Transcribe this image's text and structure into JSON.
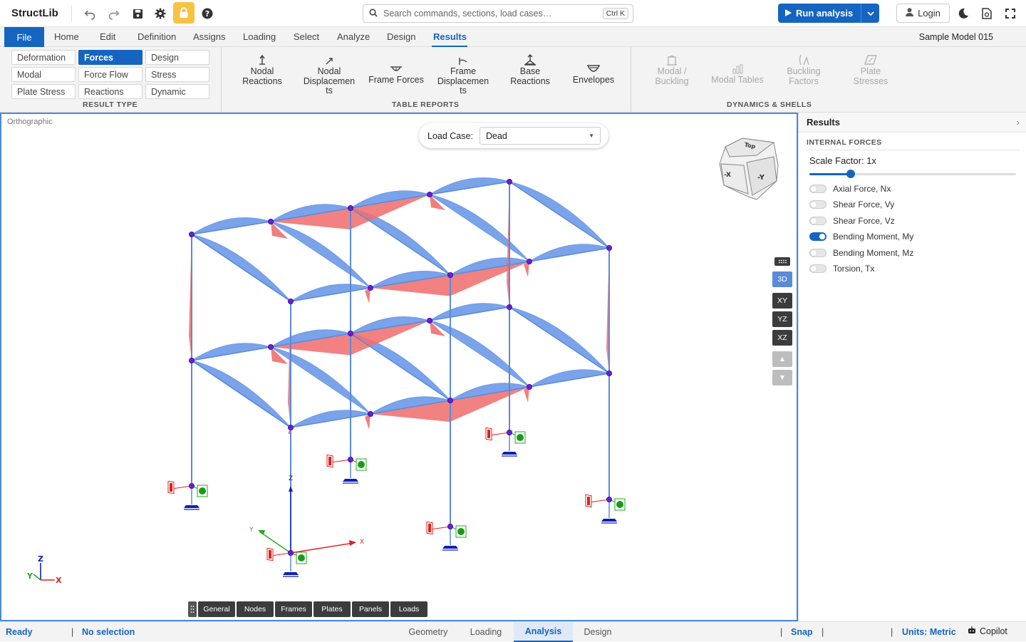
{
  "app": {
    "brand": "StructLib"
  },
  "toolbar": {
    "icons": [
      "undo-icon",
      "redo-icon",
      "save-icon",
      "settings-icon",
      "lock-icon",
      "help-icon"
    ],
    "search_placeholder": "Search commands, sections, load cases…",
    "search_shortcut": "Ctrl K",
    "run_label": "Run analysis",
    "login_label": "Login",
    "accent": "#1565c0"
  },
  "menu": {
    "file": "File",
    "items": [
      "Home",
      "Edit",
      "Definition",
      "Assigns",
      "Loading",
      "Select",
      "Analyze",
      "Design",
      "Results"
    ],
    "active": "Results",
    "model_name": "Sample Model 015"
  },
  "ribbon": {
    "result_type": {
      "label": "RESULT TYPE",
      "buttons": [
        "Deformation",
        "Forces",
        "Design",
        "Modal",
        "Force Flow",
        "Stress",
        "Plate Stress",
        "Reactions",
        "Dynamic"
      ],
      "active": "Forces"
    },
    "table_reports": {
      "label": "TABLE REPORTS",
      "buttons": [
        {
          "label": "Nodal Reactions",
          "lines": [
            "Nodal",
            "Reactions"
          ],
          "icon": "nodal-reactions-icon"
        },
        {
          "label": "Nodal Displacements",
          "lines": [
            "Nodal",
            "Displacemen",
            "ts"
          ],
          "icon": "nodal-displacements-icon"
        },
        {
          "label": "Frame Forces",
          "lines": [
            "Frame Forces"
          ],
          "icon": "frame-forces-icon"
        },
        {
          "label": "Frame Displacements",
          "lines": [
            "Frame",
            "Displacemen",
            "ts"
          ],
          "icon": "frame-displacements-icon"
        },
        {
          "label": "Base Reactions",
          "lines": [
            "Base",
            "Reactions"
          ],
          "icon": "base-reactions-icon"
        },
        {
          "label": "Envelopes",
          "lines": [
            "Envelopes"
          ],
          "icon": "envelopes-icon"
        }
      ]
    },
    "dynamics": {
      "label": "DYNAMICS & SHELLS",
      "buttons": [
        {
          "label": "Modal / Buckling",
          "lines": [
            "Modal /",
            "Buckling"
          ],
          "icon": "modal-buckling-icon"
        },
        {
          "label": "Modal Tables",
          "lines": [
            "Modal Tables"
          ],
          "icon": "modal-tables-icon"
        },
        {
          "label": "Buckling Factors",
          "lines": [
            "Buckling",
            "Factors"
          ],
          "icon": "buckling-factors-icon"
        },
        {
          "label": "Plate Stresses",
          "lines": [
            "Plate",
            "Stresses"
          ],
          "icon": "plate-stresses-icon"
        }
      ]
    }
  },
  "viewport": {
    "projection": "Orthographic",
    "load_case_label": "Load Case:",
    "load_case_value": "Dead",
    "view_buttons": [
      "3D",
      "XY",
      "YZ",
      "XZ"
    ],
    "active_view": "3D",
    "cube_faces": {
      "top": "Top",
      "front": "-Y",
      "left": "-X"
    },
    "bottom_tabs": [
      "General",
      "Nodes",
      "Frames",
      "Plates",
      "Panels",
      "Loads"
    ],
    "axes": {
      "x": "X",
      "y": "Y",
      "z": "Z"
    },
    "colors": {
      "frame": "#5b8ad8",
      "moment_pos": "#6f9be8",
      "moment_neg": "#f07070",
      "node": "#6a1fd6",
      "support": "#1020b0"
    }
  },
  "panel": {
    "title": "Results",
    "section": "INTERNAL FORCES",
    "scale_label": "Scale Factor: 1x",
    "scale_value": 1,
    "toggles": [
      {
        "label": "Axial Force, Nx",
        "on": false
      },
      {
        "label": "Shear Force, Vy",
        "on": false
      },
      {
        "label": "Shear Force, Vz",
        "on": false
      },
      {
        "label": "Bending Moment, My",
        "on": true
      },
      {
        "label": "Bending Moment, Mz",
        "on": false
      },
      {
        "label": "Torsion, Tx",
        "on": false
      }
    ]
  },
  "status": {
    "state": "Ready",
    "selection": "No selection",
    "tabs": [
      "Geometry",
      "Loading",
      "Analysis",
      "Design"
    ],
    "active_tab": "Analysis",
    "snap": "Snap",
    "units": "Units: Metric",
    "copilot": "Copilot"
  }
}
